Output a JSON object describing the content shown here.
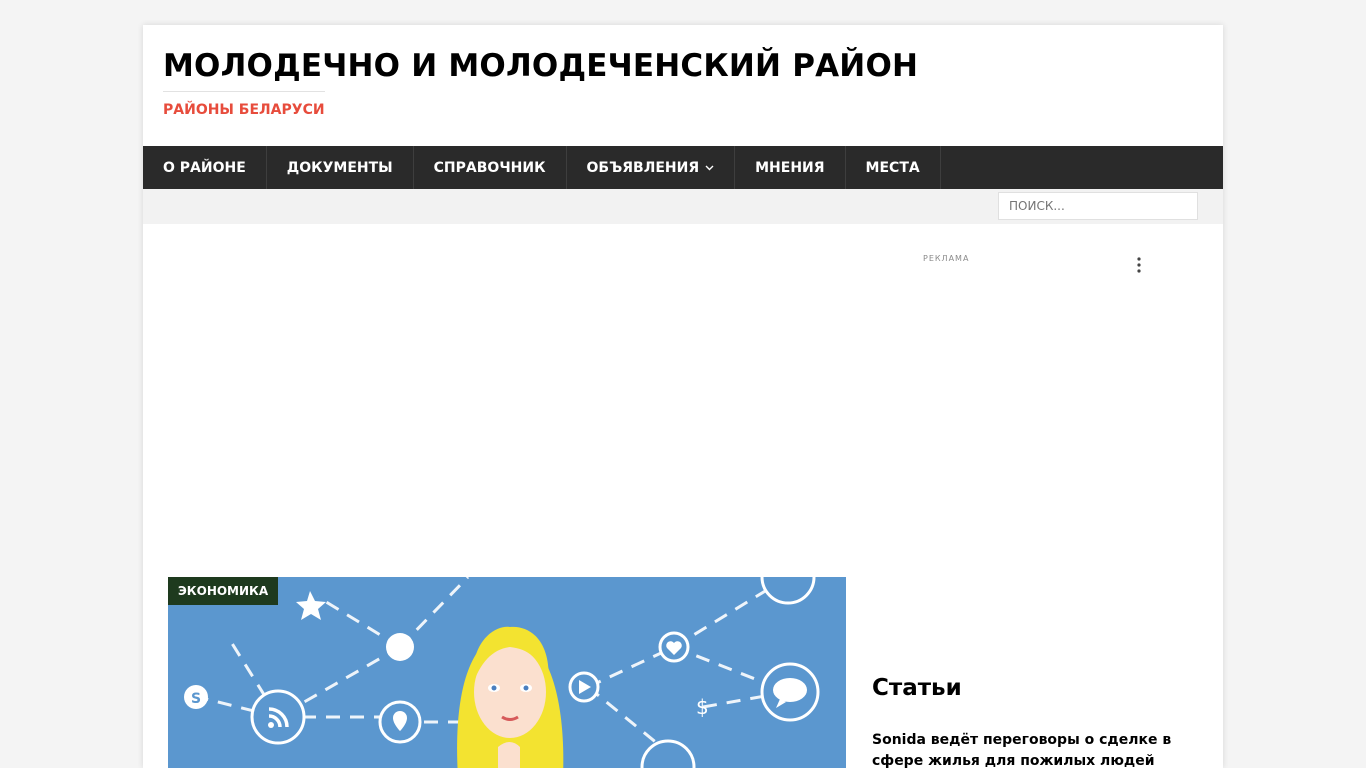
{
  "header": {
    "site_title": "МОЛОДЕЧНО И МОЛОДЕЧЕНСКИЙ РАЙОН",
    "tagline": "РАЙОНЫ БЕЛАРУСИ"
  },
  "nav": {
    "items": [
      {
        "label": "О РАЙОНЕ"
      },
      {
        "label": "ДОКУМЕНТЫ"
      },
      {
        "label": "СПРАВОЧНИК"
      },
      {
        "label": "ОБЪЯВЛЕНИЯ",
        "has_dropdown": true
      },
      {
        "label": "МНЕНИЯ"
      },
      {
        "label": "МЕСТА"
      }
    ]
  },
  "search": {
    "placeholder": "ПОИСК..."
  },
  "ad": {
    "label": "РЕКЛАМА",
    "menu_icon": "more-vertical-icon"
  },
  "featured": {
    "category": "ЭКОНОМИКА",
    "image_subject": "social-network-illustration"
  },
  "sidebar": {
    "widget_title": "Статьи",
    "articles": [
      {
        "title": "Sonida ведёт переговоры о сделке в сфере жилья для пожилых людей"
      }
    ]
  },
  "colors": {
    "accent": "#e74c3c",
    "nav_bg": "#2a2a2a",
    "badge_bg": "#1e3a1e",
    "image_bg": "#5b97cf"
  }
}
